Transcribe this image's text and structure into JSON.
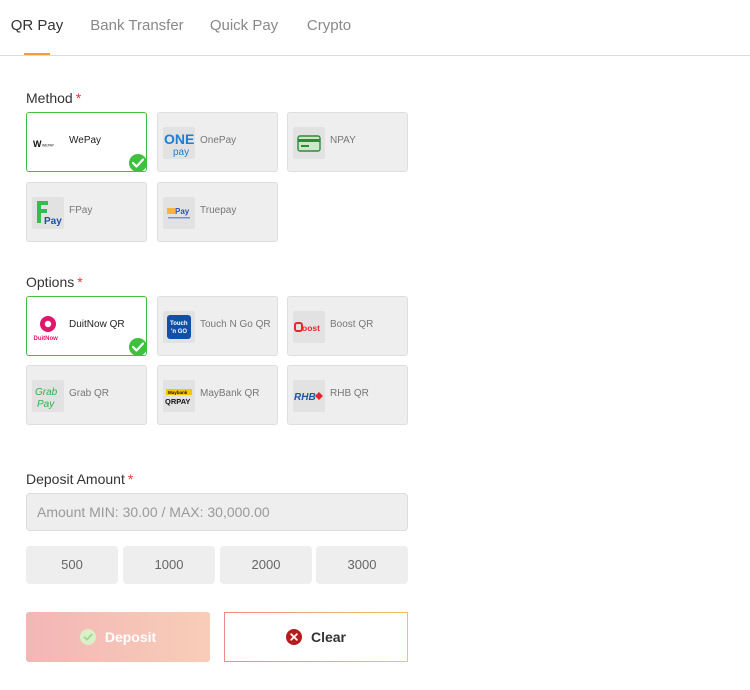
{
  "tabs": [
    {
      "label": "QR Pay",
      "active": true
    },
    {
      "label": "Bank Transfer",
      "active": false
    },
    {
      "label": "Quick Pay",
      "active": false
    },
    {
      "label": "Crypto",
      "active": false
    }
  ],
  "method": {
    "label": "Method",
    "required_mark": "*",
    "items": [
      {
        "label": "WePay",
        "icon": "wepay-logo",
        "selected": true
      },
      {
        "label": "OnePay",
        "icon": "onepay-logo",
        "selected": false
      },
      {
        "label": "NPAY",
        "icon": "npay-card-logo",
        "selected": false
      },
      {
        "label": "FPay",
        "icon": "fpay-logo",
        "selected": false
      },
      {
        "label": "Truepay",
        "icon": "truepay-logo",
        "selected": false
      }
    ]
  },
  "options": {
    "label": "Options",
    "required_mark": "*",
    "items": [
      {
        "label": "DuitNow QR",
        "icon": "duitnow-logo",
        "selected": true
      },
      {
        "label": "Touch N Go QR",
        "icon": "touchngo-logo",
        "selected": false
      },
      {
        "label": "Boost QR",
        "icon": "boost-logo",
        "selected": false
      },
      {
        "label": "Grab QR",
        "icon": "grab-logo",
        "selected": false
      },
      {
        "label": "MayBank QR",
        "icon": "maybank-qrpay-logo",
        "selected": false
      },
      {
        "label": "RHB QR",
        "icon": "rhb-logo",
        "selected": false
      }
    ]
  },
  "deposit": {
    "label": "Deposit Amount",
    "required_mark": "*",
    "placeholder": "Amount MIN: 30.00 / MAX: 30,000.00",
    "value": "",
    "quick_amounts": [
      "500",
      "1000",
      "2000",
      "3000"
    ]
  },
  "actions": {
    "deposit_label": "Deposit",
    "clear_label": "Clear"
  },
  "logo_text": {
    "wepay": "WEPAY",
    "onepay_top": "ONE",
    "onepay_bottom": "pay",
    "fpay": "Pay",
    "truepay": "Pay",
    "duitnow": "DuitNow",
    "tng_top": "Touch",
    "tng_bottom": "'n GO",
    "boost": "oost",
    "grab_top": "Grab",
    "grab_bottom": "Pay",
    "maybank_top": "Maybank",
    "maybank_bottom": "QRPAY",
    "rhb": "RHB"
  },
  "colors": {
    "accent": "#f0a030",
    "selected_border": "#3ec13e",
    "required": "#e53935",
    "clear_icon": "#b71c1c"
  }
}
